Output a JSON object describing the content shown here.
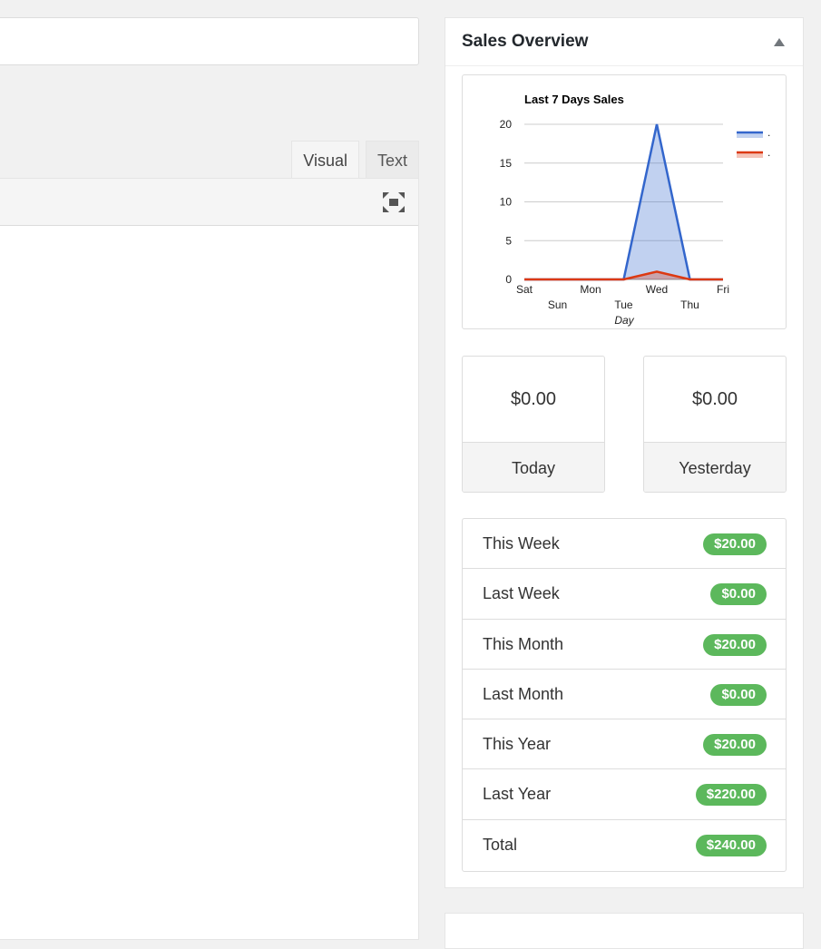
{
  "editor": {
    "tabs": [
      {
        "label": "Visual",
        "active": true
      },
      {
        "label": "Text",
        "active": false
      }
    ],
    "fullscreen_icon": "fullscreen-icon"
  },
  "sales_overview": {
    "title": "Sales Overview",
    "toggle_icon": "triangle-up-icon",
    "today": {
      "amount": "$0.00",
      "label": "Today"
    },
    "yesterday": {
      "amount": "$0.00",
      "label": "Yesterday"
    },
    "totals": [
      {
        "label": "This Week",
        "value": "$20.00"
      },
      {
        "label": "Last Week",
        "value": "$0.00"
      },
      {
        "label": "This Month",
        "value": "$20.00"
      },
      {
        "label": "Last Month",
        "value": "$0.00"
      },
      {
        "label": "This Year",
        "value": "$20.00"
      },
      {
        "label": "Last Year",
        "value": "$220.00"
      },
      {
        "label": "Total",
        "value": "$240.00"
      }
    ],
    "badge_color": "#5cb85c"
  },
  "chart_data": {
    "type": "area",
    "title": "Last 7 Days Sales",
    "xlabel": "Day",
    "ylabel": "",
    "categories": [
      "Sat",
      "Sun",
      "Mon",
      "Tue",
      "Wed",
      "Thu",
      "Fri"
    ],
    "ylim": [
      0,
      20
    ],
    "yticks": [
      0,
      5,
      10,
      15,
      20
    ],
    "grid": true,
    "legend_position": "right",
    "series": [
      {
        "name": ".",
        "color": "#3366cc",
        "values": [
          0,
          0,
          0,
          0,
          20,
          0,
          0
        ]
      },
      {
        "name": ".",
        "color": "#dc3912",
        "values": [
          0,
          0,
          0,
          0,
          1,
          0,
          0
        ]
      }
    ]
  }
}
